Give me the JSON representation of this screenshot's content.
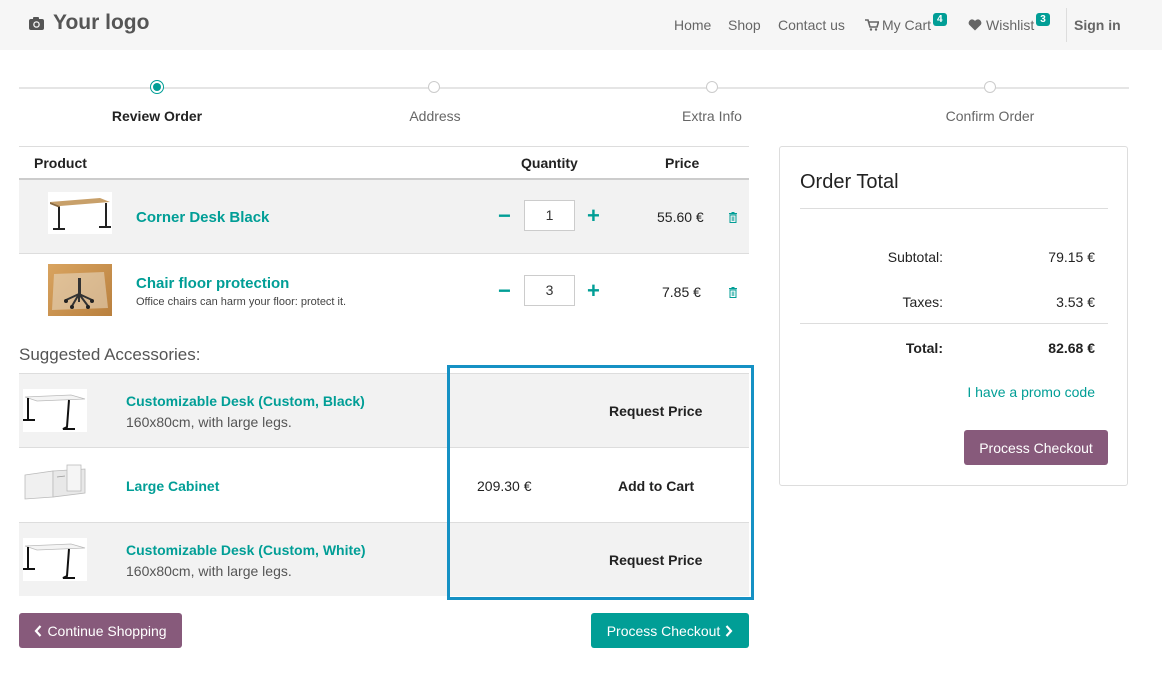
{
  "header": {
    "logo_text": "Your logo",
    "nav": [
      "Home",
      "Shop",
      "Contact us"
    ],
    "cart_label": "My Cart",
    "cart_count": "4",
    "wishlist_label": "Wishlist",
    "wishlist_count": "3",
    "signin_label": "Sign in"
  },
  "wizard": {
    "steps": [
      "Review Order",
      "Address",
      "Extra Info",
      "Confirm Order"
    ],
    "active_step": 0
  },
  "cart": {
    "headers": {
      "product": "Product",
      "quantity": "Quantity",
      "price": "Price"
    },
    "lines": [
      {
        "name": "Corner Desk Black",
        "description": "",
        "quantity": "1",
        "price": "55.60 €"
      },
      {
        "name": "Chair floor protection",
        "description": "Office chairs can harm your floor: protect it.",
        "quantity": "3",
        "price": "7.85 €"
      }
    ]
  },
  "accessories": {
    "title": "Suggested Accessories:",
    "items": [
      {
        "name": "Customizable Desk (Custom, Black)",
        "description": "160x80cm, with large legs.",
        "price": "",
        "action": "Request Price"
      },
      {
        "name": "Large Cabinet",
        "description": "",
        "price": "209.30 €",
        "action": "Add to Cart"
      },
      {
        "name": "Customizable Desk (Custom, White)",
        "description": "160x80cm, with large legs.",
        "price": "",
        "action": "Request Price"
      }
    ]
  },
  "buttons": {
    "continue_shopping": "Continue Shopping",
    "process_checkout": "Process Checkout"
  },
  "order_total": {
    "title": "Order Total",
    "subtotal_label": "Subtotal:",
    "subtotal": "79.15 €",
    "taxes_label": "Taxes:",
    "taxes": "3.53 €",
    "total_label": "Total:",
    "total": "82.68 €",
    "promo_label": "I have a promo code",
    "checkout_label": "Process Checkout"
  },
  "colors": {
    "primary": "#019e96",
    "secondary": "#875a7b",
    "highlight": "#1591c4"
  }
}
